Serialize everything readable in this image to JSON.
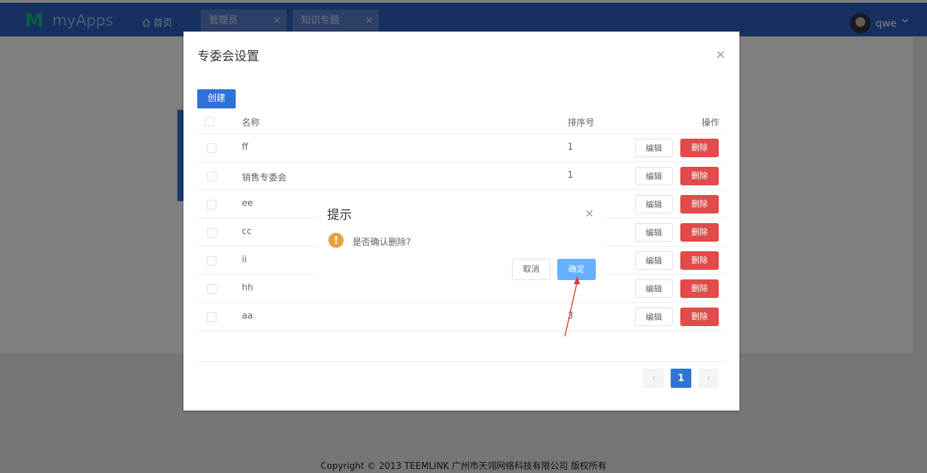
{
  "header": {
    "logo_mark": "M",
    "logo_text": "myApps",
    "home_label": "首页",
    "tabs": [
      {
        "label": "管理员",
        "close": "×"
      },
      {
        "label": "知识专题",
        "close": "×"
      }
    ],
    "user_name": "qwe"
  },
  "dialog": {
    "title": "专委会设置",
    "close": "×",
    "create_label": "创建",
    "columns": {
      "name": "名称",
      "sort": "排序号",
      "actions": "操作"
    },
    "rows": [
      {
        "name": "ff",
        "sort": "1"
      },
      {
        "name": "销售专委会",
        "sort": "1"
      },
      {
        "name": "ee",
        "sort": ""
      },
      {
        "name": "cc",
        "sort": ""
      },
      {
        "name": "ii",
        "sort": ""
      },
      {
        "name": "hh",
        "sort": ""
      },
      {
        "name": "aa",
        "sort": "3"
      }
    ],
    "edit_label": "编辑",
    "delete_label": "删除",
    "pagination": {
      "prev": "‹",
      "current": "1",
      "next": "›"
    }
  },
  "confirm": {
    "title": "提示",
    "close": "×",
    "icon": "!",
    "message": "是否确认删除?",
    "cancel_label": "取消",
    "ok_label": "确定"
  },
  "footer": {
    "copyright": "Copyright © 2013 TEEMLINK 广州市天翎网络科技有限公司 版权所有"
  },
  "colors": {
    "nav": "#2d62c2",
    "primary": "#2f73d7",
    "danger": "#e14b4b",
    "warning": "#e6a23c",
    "annotation_arrow": "#e53935"
  }
}
